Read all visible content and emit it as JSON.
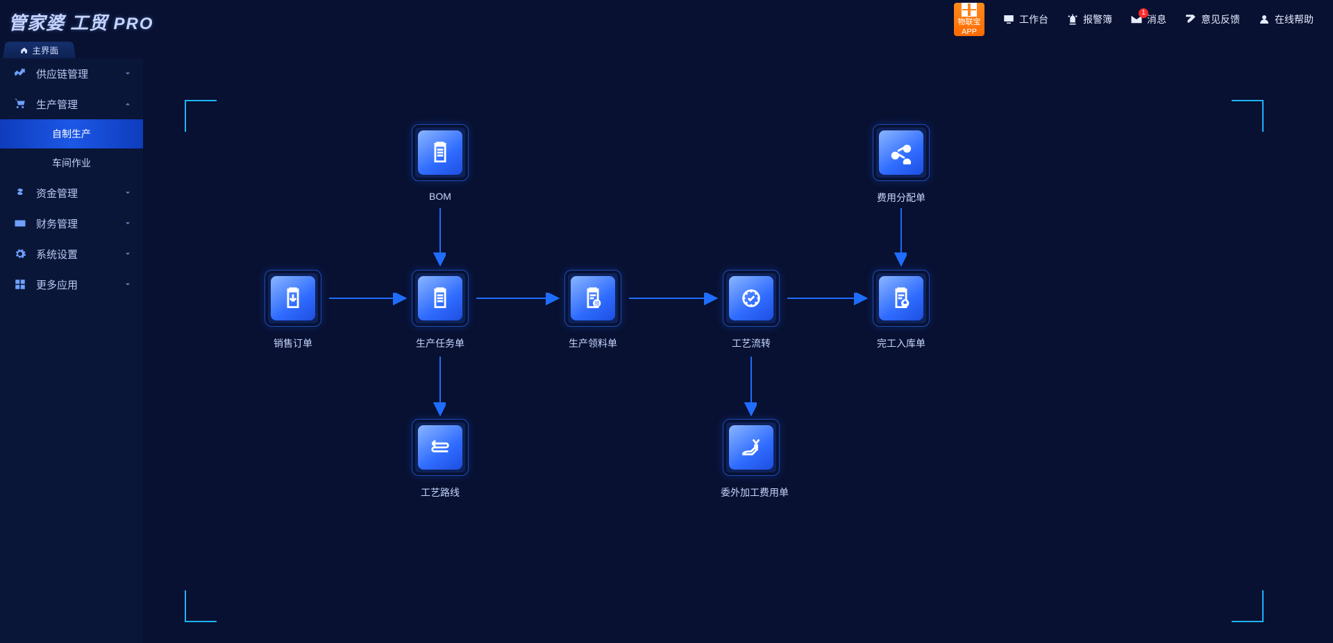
{
  "logo_main": "管家婆 工贸",
  "logo_pro": "PRO",
  "app_badge": {
    "line1": "物联宝",
    "line2": "APP"
  },
  "topbar": {
    "workbench": "工作台",
    "alarm": "报警簿",
    "message": "消息",
    "message_badge": "1",
    "feedback": "意见反馈",
    "help": "在线帮助"
  },
  "tab_main": "主界面",
  "sidebar": {
    "supply_chain": "供应链管理",
    "production": "生产管理",
    "production_sub": {
      "self_made": "自制生产",
      "workshop": "车间作业"
    },
    "funds": "资金管理",
    "finance": "财务管理",
    "system": "系统设置",
    "more_apps": "更多应用"
  },
  "nodes": {
    "bom": "BOM",
    "sales_order": "销售订单",
    "prod_task": "生产任务单",
    "prod_pick": "生产领料单",
    "process_flow": "工艺流转",
    "finish_in": "完工入库单",
    "process_route": "工艺路线",
    "outsource_cost": "委外加工费用单",
    "cost_alloc": "费用分配单"
  }
}
